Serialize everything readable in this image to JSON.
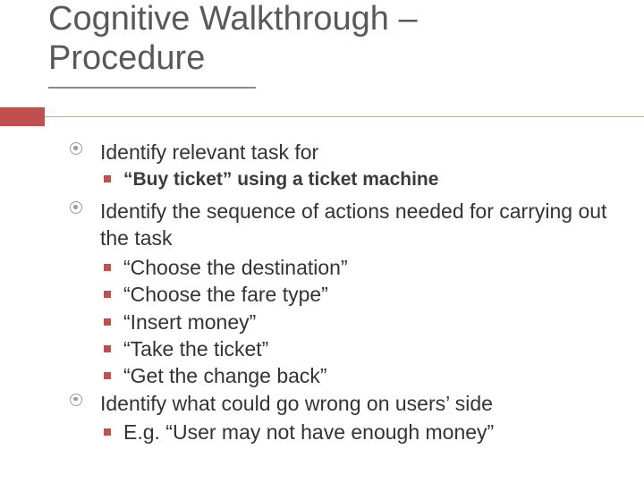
{
  "title_l1": "Cognitive Walkthrough –",
  "title_l2": "Procedure",
  "items": [
    {
      "text": "Identify relevant task for",
      "sub_emph": "“Buy ticket” using a ticket machine"
    },
    {
      "text": "Identify the sequence of actions needed for carrying out the task",
      "subs": [
        "“Choose the destination”",
        "“Choose the fare type”",
        "“Insert money”",
        "“Take the ticket”",
        "“Get the change back”"
      ]
    },
    {
      "text": "Identify what could go wrong on users’ side",
      "subs": [
        "E.g. “User may not have enough money”"
      ]
    }
  ]
}
